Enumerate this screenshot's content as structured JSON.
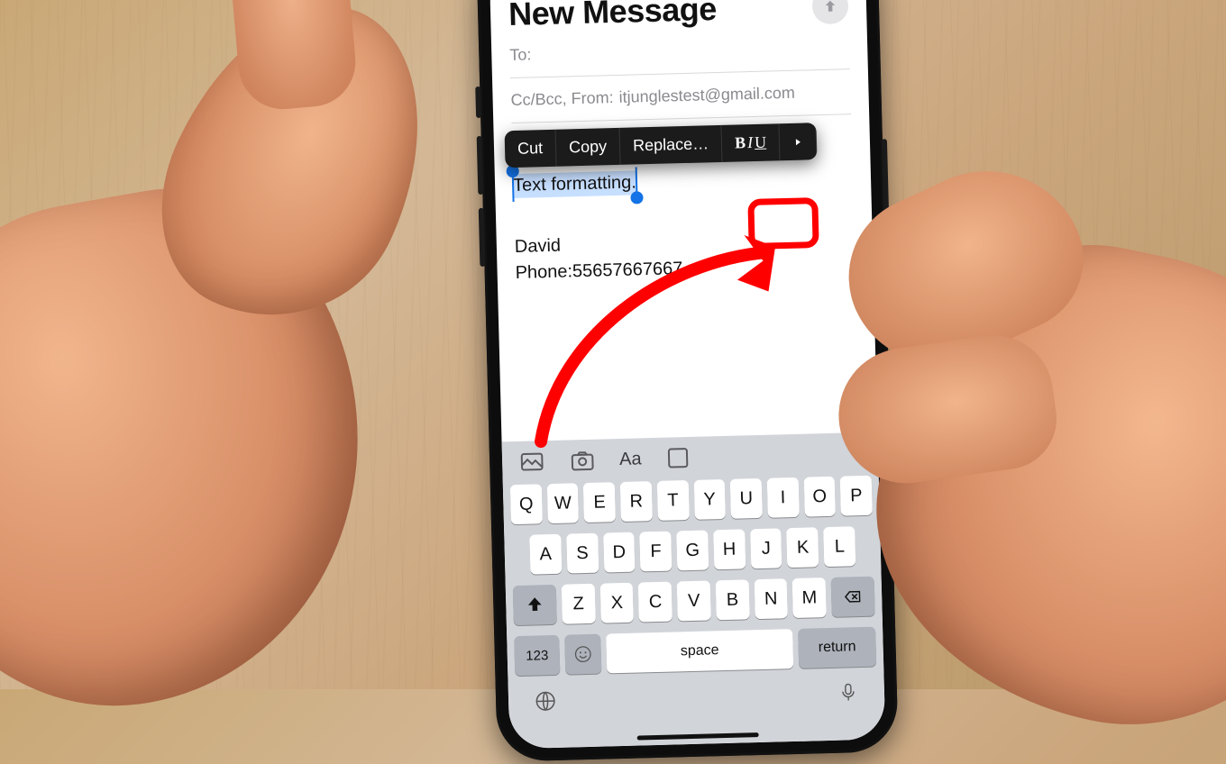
{
  "compose": {
    "title": "New Message",
    "to_label": "To:",
    "cc_label": "Cc/Bcc, From:",
    "from_email": "itjunglestest@gmail.com",
    "selected_text": "Text formatting.",
    "signature_name": "David",
    "signature_phone_label": "Phone:",
    "signature_phone": "55657667667"
  },
  "edit_menu": {
    "cut": "Cut",
    "copy": "Copy",
    "replace": "Replace…",
    "biu_b": "B",
    "biu_i": "I",
    "biu_u": "U"
  },
  "keyboard": {
    "aa": "Aa",
    "row1": [
      "Q",
      "W",
      "E",
      "R",
      "T",
      "Y",
      "U",
      "I",
      "O",
      "P"
    ],
    "row2": [
      "A",
      "S",
      "D",
      "F",
      "G",
      "H",
      "J",
      "K",
      "L"
    ],
    "row3": [
      "Z",
      "X",
      "C",
      "V",
      "B",
      "N",
      "M"
    ],
    "n123": "123",
    "space": "space",
    "ret": "return"
  }
}
